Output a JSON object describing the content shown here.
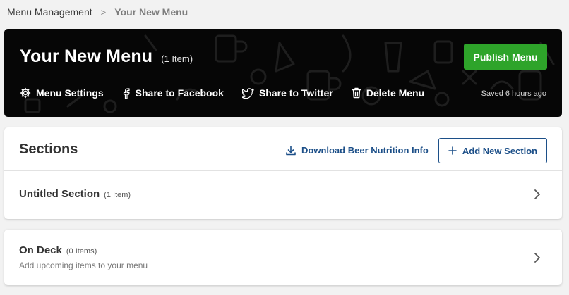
{
  "breadcrumb": {
    "parent": "Menu Management",
    "separator": ">",
    "current": "Your New Menu"
  },
  "hero": {
    "title": "Your New Menu",
    "item_count": "(1 Item)",
    "publish_label": "Publish Menu",
    "saved_status": "Saved 6 hours ago",
    "actions": [
      {
        "label": "Menu Settings",
        "icon": "gear-icon"
      },
      {
        "label": "Share to Facebook",
        "icon": "facebook-icon"
      },
      {
        "label": "Share to Twitter",
        "icon": "twitter-icon"
      },
      {
        "label": "Delete Menu",
        "icon": "trash-icon"
      }
    ]
  },
  "sections": {
    "title": "Sections",
    "download_label": "Download Beer Nutrition Info",
    "add_label": "Add New Section",
    "rows": [
      {
        "title": "Untitled Section",
        "count": "(1 Item)"
      }
    ]
  },
  "on_deck": {
    "title": "On Deck",
    "count": "(0 Items)",
    "subtitle": "Add upcoming items to your menu"
  },
  "colors": {
    "publish_green": "#2ea42a",
    "link_blue": "#1c4f88",
    "hero_bg": "#060606",
    "page_bg": "#f2f2f2"
  }
}
